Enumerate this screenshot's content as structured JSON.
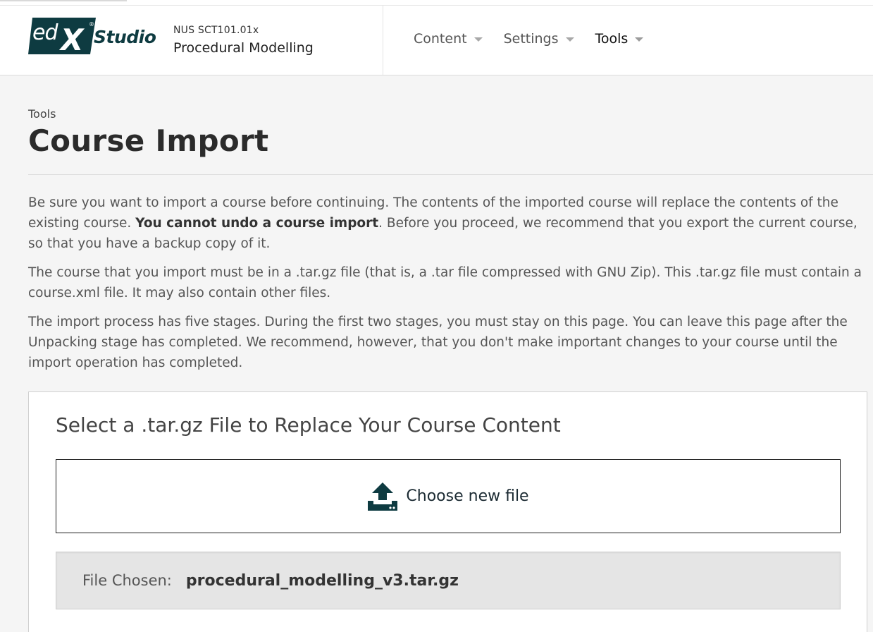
{
  "header": {
    "logo_edx": "edX",
    "logo_studio": "Studio",
    "course_org": "NUS SCT101.01x",
    "course_title": "Procedural Modelling",
    "nav": [
      {
        "label": "Content",
        "active": false
      },
      {
        "label": "Settings",
        "active": false
      },
      {
        "label": "Tools",
        "active": true
      }
    ]
  },
  "page": {
    "breadcrumb": "Tools",
    "title": "Course Import"
  },
  "intro": {
    "p1_before": "Be sure you want to import a course before continuing. The contents of the imported course will replace the contents of the existing course. ",
    "p1_bold": "You cannot undo a course import",
    "p1_after": ". Before you proceed, we recommend that you export the current course, so that you have a backup copy of it.",
    "p2": "The course that you import must be in a .tar.gz file (that is, a .tar file compressed with GNU Zip). This .tar.gz file must contain a course.xml file. It may also contain other files.",
    "p3": "The import process has five stages. During the first two stages, you must stay on this page. You can leave this page after the Unpacking stage has completed. We recommend, however, that you don't make important changes to your course until the import operation has completed."
  },
  "import_panel": {
    "title": "Select a .tar.gz File to Replace Your Course Content",
    "choose_label": "Choose new file",
    "file_chosen_label": "File Chosen:",
    "file_chosen_value": "procedural_modelling_v3.tar.gz"
  },
  "colors": {
    "brand_dark": "#0e3b41",
    "page_bg": "#f5f5f5",
    "file_chosen_bg": "#e5e5e5"
  },
  "icons": {
    "logo": "edx-logo-icon",
    "upload": "upload-icon",
    "caret": "caret-down-icon"
  }
}
